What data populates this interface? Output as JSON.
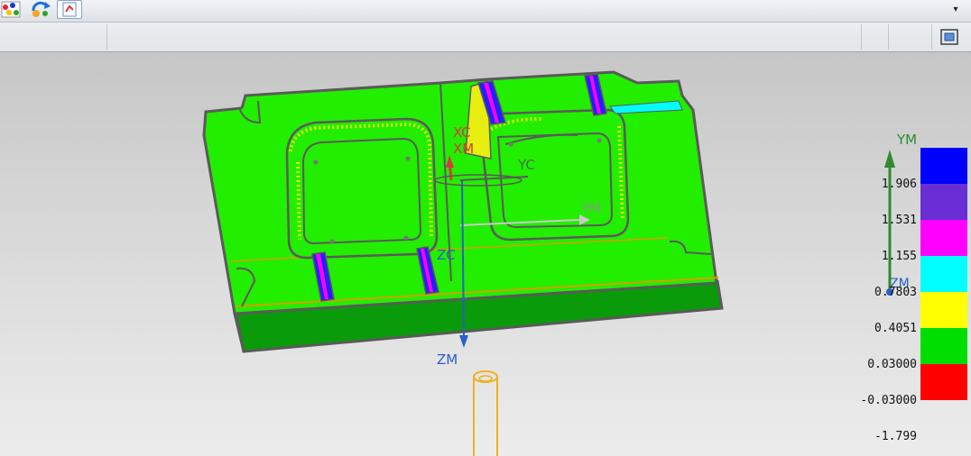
{
  "toolbar": {
    "icons": [
      "multi-point-icon",
      "rotate-arrows-icon",
      "analysis-icon"
    ],
    "dropdown_glyph": "▾",
    "fit_icon": "fit-view-icon"
  },
  "triad_labels": {
    "xc": "XC",
    "xm": "XM",
    "yc": "YC",
    "ym": "YM",
    "zc": "ZC",
    "zm": "ZM"
  },
  "legend": {
    "axis_ym": "YM",
    "axis_zm": "ZM",
    "values": [
      "1.906",
      "1.531",
      "1.155",
      "0.7803",
      "0.4051",
      "0.03000",
      "-0.03000",
      "-1.799"
    ],
    "colors": [
      "#0000ff",
      "#6a2fd4",
      "#ff00ff",
      "#00ffff",
      "#ffff00",
      "#00dd00",
      "#ff0000"
    ]
  },
  "colors": {
    "part_top": "#22ee00",
    "part_side": "#0a9b0a",
    "outline": "#5a5a5a",
    "axis_red": "#d83a3a",
    "axis_green": "#2e8b2e",
    "axis_blue": "#2a5fc7",
    "tool": "#f0b020"
  }
}
